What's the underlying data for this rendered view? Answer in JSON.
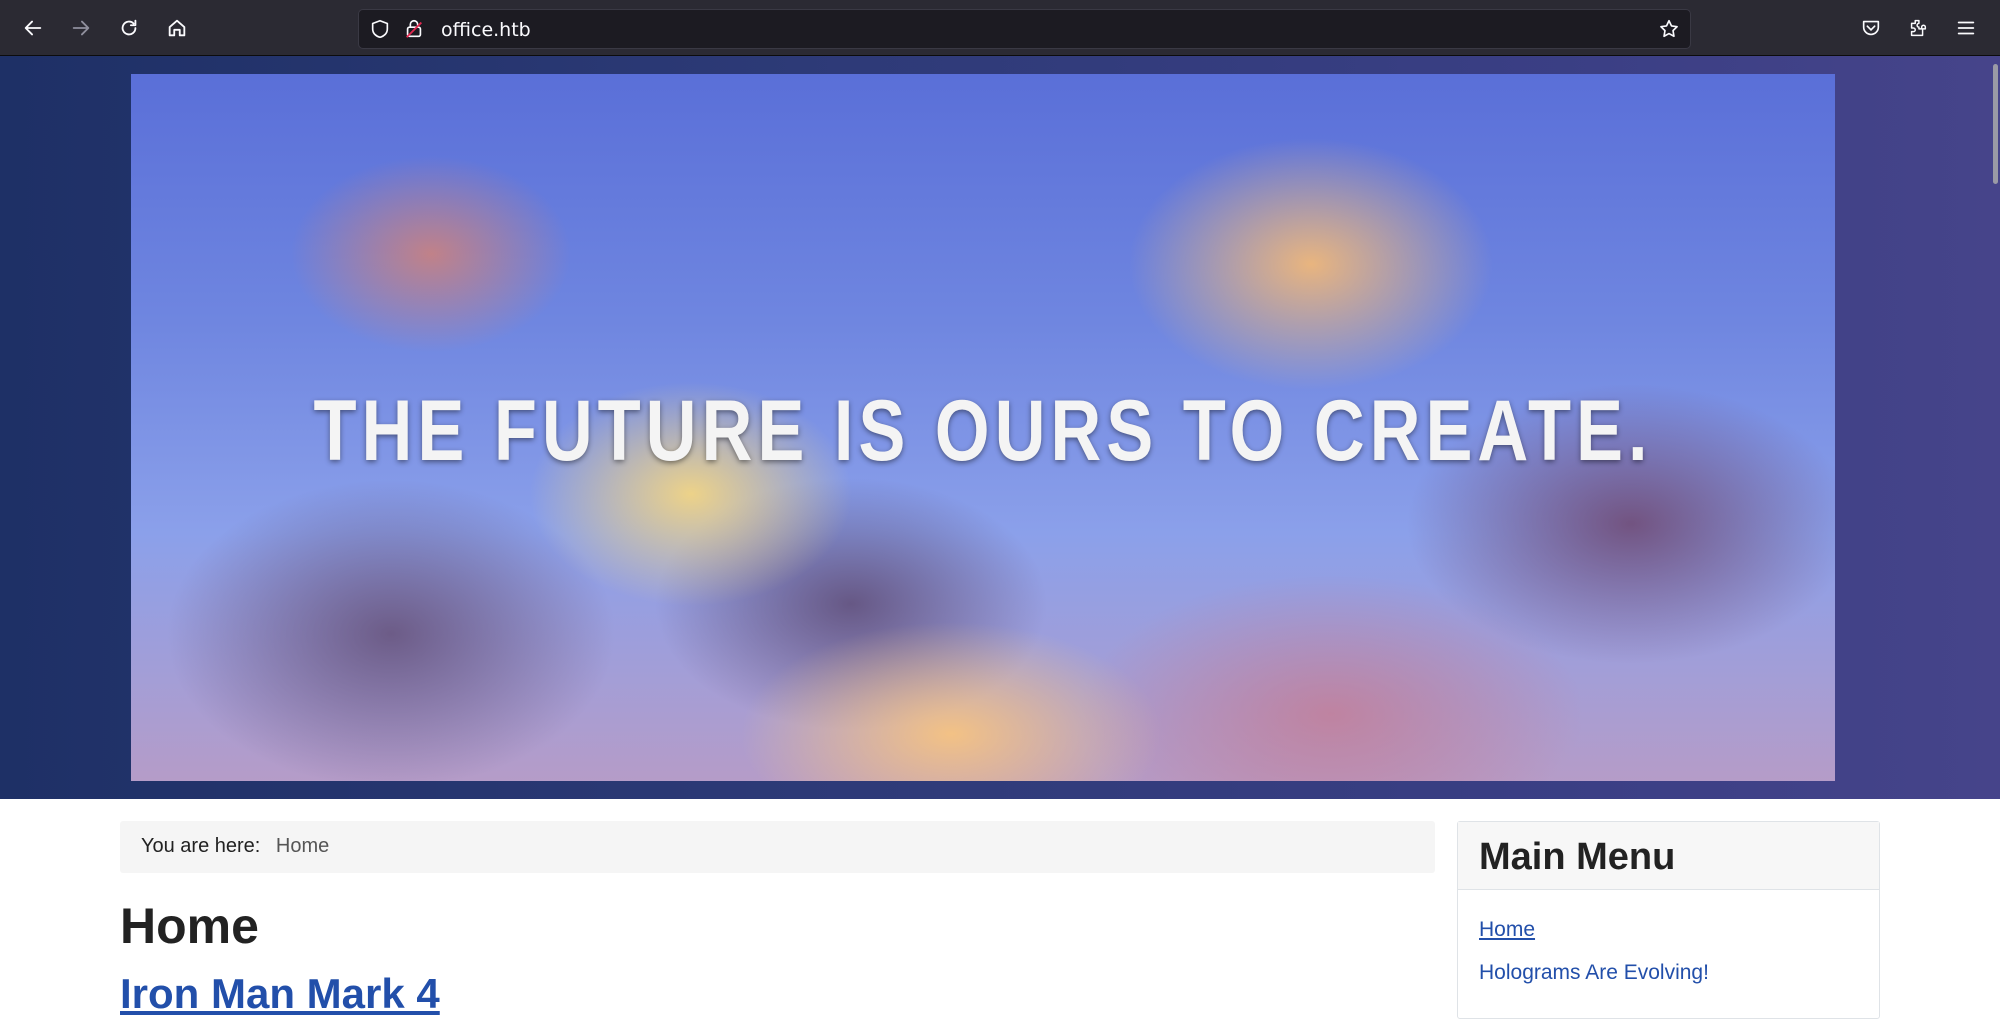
{
  "browser": {
    "url": "office.htb",
    "icons": {
      "back": "arrow-left-icon",
      "forward": "arrow-right-icon",
      "reload": "reload-icon",
      "home": "home-icon",
      "shield": "shield-icon",
      "lock": "lock-icon",
      "bookmark": "star-icon",
      "pocket": "pocket-icon",
      "extensions": "puzzle-icon",
      "menu": "hamburger-icon"
    }
  },
  "banner": {
    "text": "THE FUTURE IS OURS TO CREATE."
  },
  "breadcrumb": {
    "prefix": "You are here:",
    "current": "Home"
  },
  "main": {
    "title": "Home",
    "article_link": "Iron Man Mark 4"
  },
  "sidebar": {
    "module_title": "Main Menu",
    "items": [
      {
        "label": "Home",
        "active": true
      },
      {
        "label": "Holograms Are Evolving!",
        "active": false
      }
    ]
  },
  "colors": {
    "link": "#224faa",
    "header_bg": "#2d3a77",
    "toolbar_bg": "#2b2a33"
  }
}
